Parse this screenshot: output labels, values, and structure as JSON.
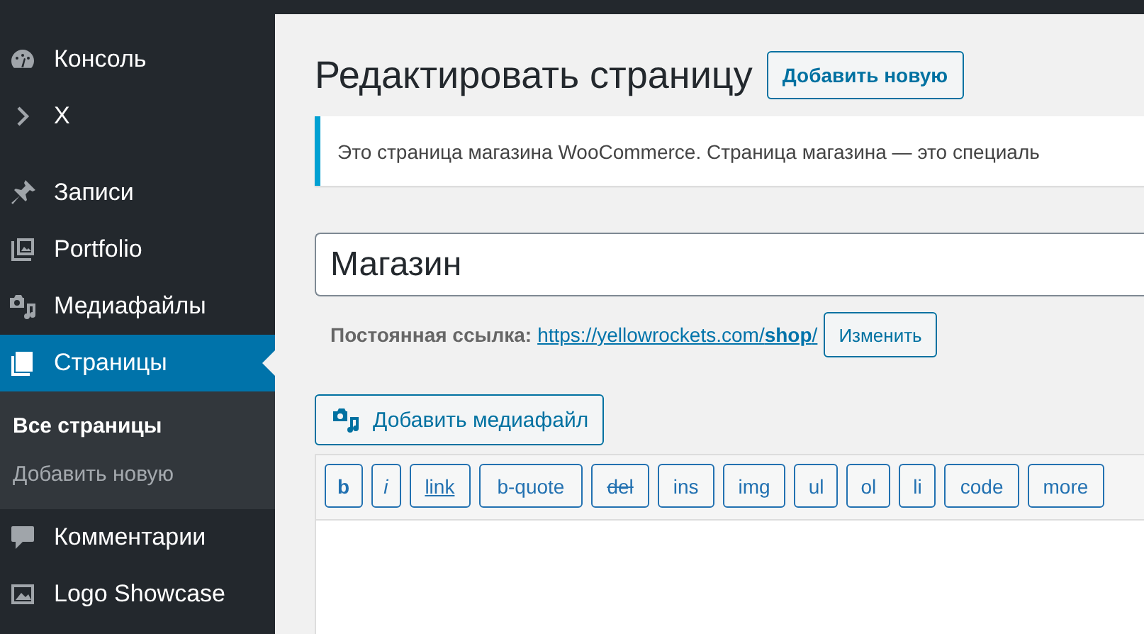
{
  "sidebar": {
    "items": [
      {
        "label": "Консоль",
        "selected": false
      },
      {
        "label": "X",
        "selected": false
      },
      {
        "label": "Записи",
        "selected": false
      },
      {
        "label": "Portfolio",
        "selected": false
      },
      {
        "label": "Медиафайлы",
        "selected": false
      },
      {
        "label": "Страницы",
        "selected": true,
        "submenu": [
          {
            "label": "Все страницы",
            "selected": true
          },
          {
            "label": "Добавить новую",
            "selected": false
          }
        ]
      },
      {
        "label": "Комментарии",
        "selected": false
      },
      {
        "label": "Logo Showcase",
        "selected": false
      }
    ]
  },
  "page": {
    "title": "Редактировать страницу",
    "add_new_button": "Добавить новую",
    "notice": "Это страница магазина WooCommerce. Страница магазина — это специаль",
    "title_field": "Магазин",
    "permalink": {
      "label": "Постоянная ссылка:",
      "url": "https://yellowrockets.com/**shop**/",
      "edit_button": "Изменить"
    },
    "add_media_button": "Добавить медиафайл",
    "quicktags": [
      {
        "label": "b",
        "kind": "bold"
      },
      {
        "label": "i",
        "kind": "italic"
      },
      {
        "label": "link",
        "kind": "underline"
      },
      {
        "label": "b-quote",
        "kind": "plain"
      },
      {
        "label": "del",
        "kind": "strike"
      },
      {
        "label": "ins",
        "kind": "plain"
      },
      {
        "label": "img",
        "kind": "plain"
      },
      {
        "label": "ul",
        "kind": "plain"
      },
      {
        "label": "ol",
        "kind": "plain"
      },
      {
        "label": "li",
        "kind": "plain"
      },
      {
        "label": "code",
        "kind": "plain"
      },
      {
        "label": "more",
        "kind": "plain"
      }
    ]
  }
}
